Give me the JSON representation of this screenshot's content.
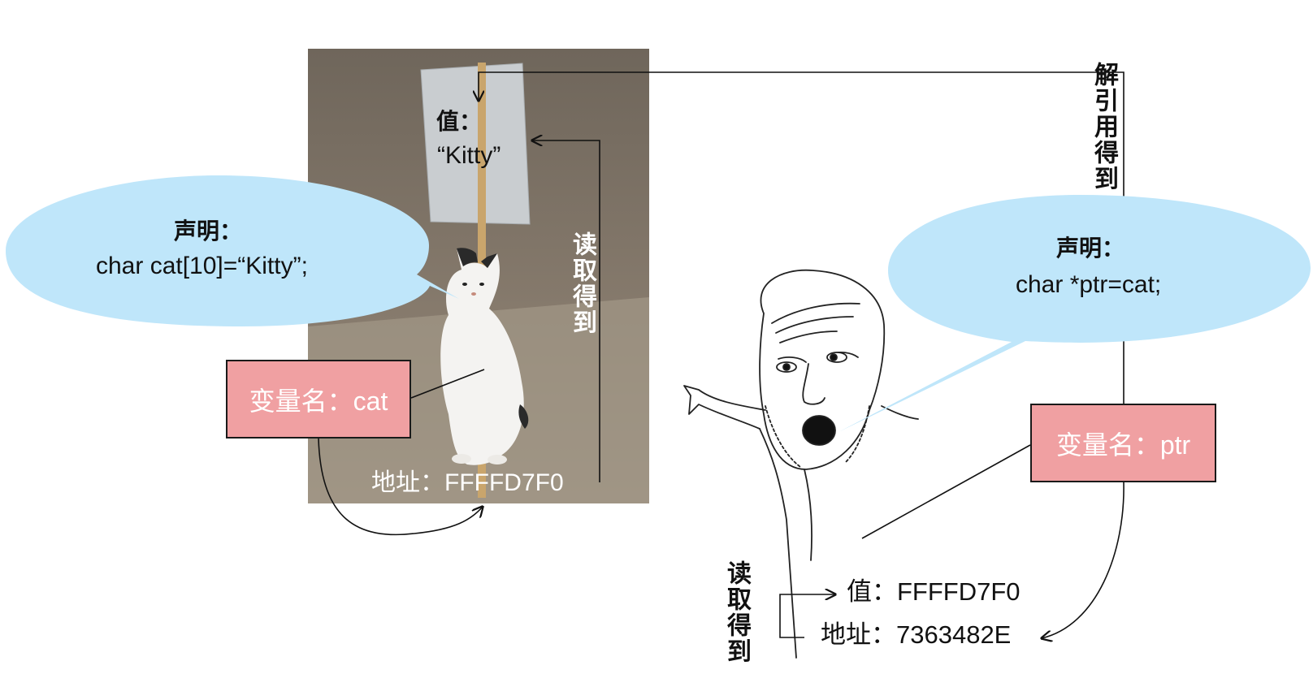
{
  "colors": {
    "bubble": "#bfe6fa",
    "name_box": "#f0a0a2",
    "photo_bg": "#7e7366",
    "line": "#111111"
  },
  "cat_photo": {
    "sign_value_label": "值：",
    "sign_value_text": "“Kitty”",
    "address_text": "地址：FFFFD7F0",
    "read_arrow_label": "读取得到"
  },
  "cat_declaration": {
    "label": "声明：",
    "code": "char cat[10]=“Kitty”;"
  },
  "cat_name_box": {
    "text": "变量名：cat"
  },
  "ptr_declaration": {
    "label": "声明：",
    "code": "char *ptr=cat;"
  },
  "ptr_name_box": {
    "text": "变量名：ptr"
  },
  "dereference_label": "解引用得到",
  "ptr_read_label": "读取得到",
  "ptr_value_text": "值：FFFFD7F0",
  "ptr_address_text": "地址：7363482E"
}
